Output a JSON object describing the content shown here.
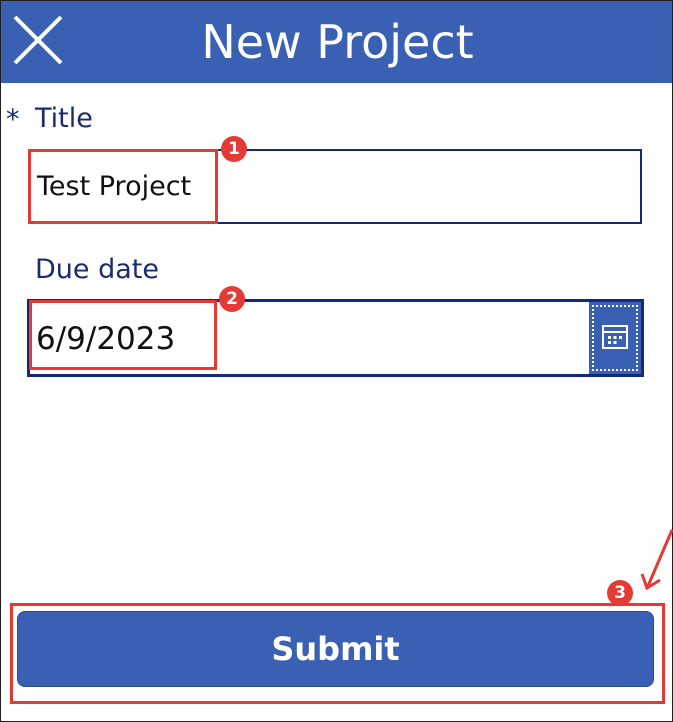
{
  "header": {
    "title": "New Project",
    "close_icon": "close-icon",
    "background_color": "#3a60b4"
  },
  "form": {
    "required_marker": "*",
    "title_label": "Title",
    "title_value": "Test Project",
    "due_date_label": "Due date",
    "due_date_value": "6/9/2023",
    "calendar_icon": "calendar-icon"
  },
  "submit": {
    "label": "Submit"
  },
  "annotations": {
    "badge_1": "1",
    "badge_2": "2",
    "badge_3": "3",
    "highlight_color": "#e53935"
  }
}
